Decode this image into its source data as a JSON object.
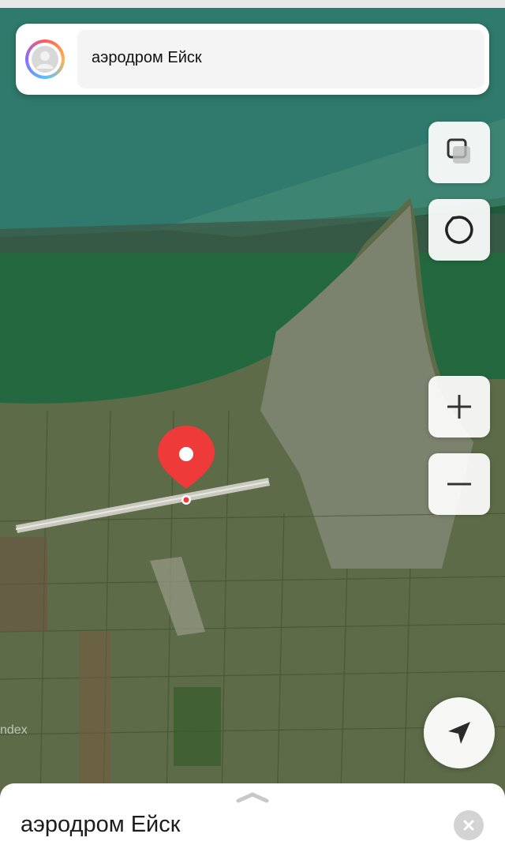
{
  "search": {
    "query": "аэродром Ейск"
  },
  "sheet": {
    "title": "аэродром Ейск"
  },
  "map": {
    "watermark": "ndex",
    "marker_color": "#ef3a3a"
  },
  "controls": {
    "layers_icon": "layers-icon",
    "rotate_icon": "rotate-icon",
    "zoom_in_icon": "plus-icon",
    "zoom_out_icon": "minus-icon",
    "locate_icon": "navigation-arrow-icon",
    "close_icon": "close-icon"
  }
}
